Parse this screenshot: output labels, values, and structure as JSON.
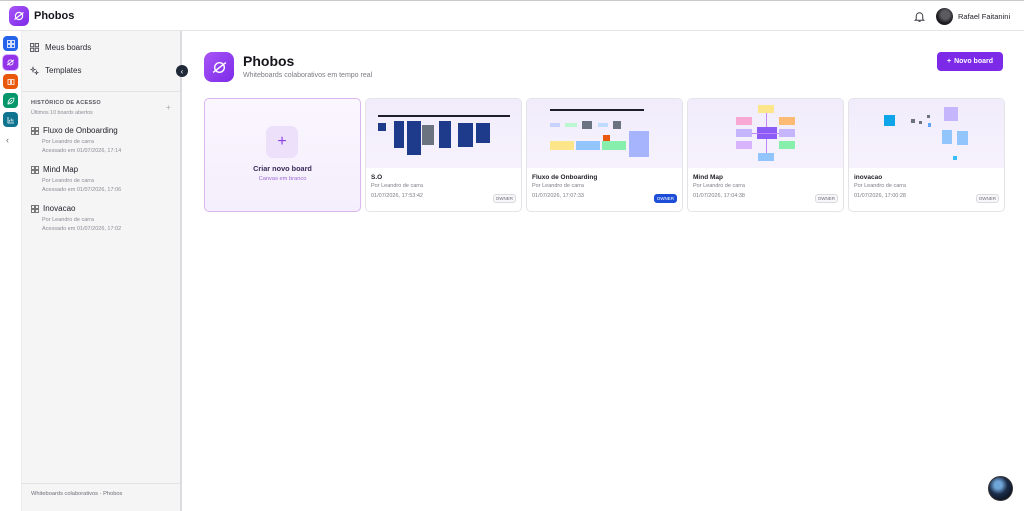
{
  "app": {
    "name": "Phobos"
  },
  "user": {
    "name": "Rafael Faitanini"
  },
  "colors": {
    "accent": "#7c2ae8",
    "rail": [
      "#2563eb",
      "#9333ea",
      "#ea580c",
      "#059669",
      "#0e7490"
    ]
  },
  "sidebar": {
    "nav": [
      {
        "label": "Meus boards",
        "icon": "grid-icon"
      },
      {
        "label": "Templates",
        "icon": "sparkles-icon"
      }
    ],
    "history_title": "HISTÓRICO DE ACESSO",
    "history_subtitle": "Últimos 10 boards abertos",
    "history": [
      {
        "name": "Fluxo de Onboarding",
        "by": "Por Leandro de carra",
        "accessed": "Acessado em 01/07/2026, 17:14"
      },
      {
        "name": "Mind Map",
        "by": "Por Leandro de carra",
        "accessed": "Acessado em 01/07/2026, 17:06"
      },
      {
        "name": "Inovacao",
        "by": "Por Leandro de carra",
        "accessed": "Acessado em 01/07/2026, 17:02"
      }
    ],
    "footer": "Whiteboards colaborativos · Phobos"
  },
  "main": {
    "title": "Phobos",
    "subtitle": "Whiteboards colaborativos em tempo real",
    "new_board_label": "Novo board",
    "create": {
      "title": "Criar novo board",
      "subtitle": "Canvas em branco"
    },
    "boards": [
      {
        "title": "S.O",
        "by": "Por Leandro de carra",
        "date": "01/07/2026, 17:53:42",
        "badge": "OWNER"
      },
      {
        "title": "Fluxo de Onboarding",
        "by": "Por Leandro de carra",
        "date": "01/07/2026, 17:07:33",
        "badge": "OWNER"
      },
      {
        "title": "Mind Map",
        "by": "Por Leandro de carra",
        "date": "01/07/2026, 17:04:38",
        "badge": "OWNER"
      },
      {
        "title": "inovacao",
        "by": "Por Leandro de carra",
        "date": "01/07/2026, 17:00:28",
        "badge": "OWNER"
      }
    ]
  }
}
